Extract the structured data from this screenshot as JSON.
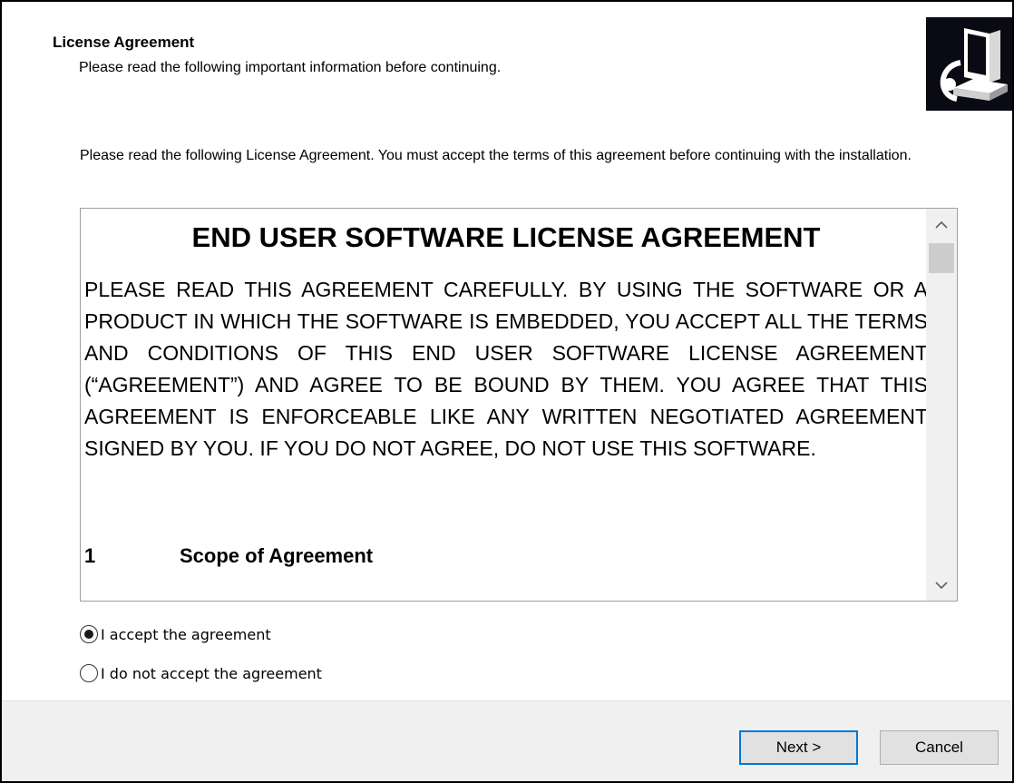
{
  "header": {
    "title": "License Agreement",
    "subtitle": "Please read the following important information before continuing.",
    "logo_icon": "installer-computer-icon"
  },
  "intro": {
    "text": "Please read the following License Agreement. You must accept the terms of this agreement before continuing with the installation."
  },
  "license": {
    "heading": "END USER SOFTWARE LICENSE AGREEMENT",
    "body": "PLEASE READ THIS AGREEMENT CAREFULLY. BY USING THE SOFTWARE OR A PRODUCT IN WHICH THE SOFTWARE IS EMBEDDED, YOU ACCEPT ALL THE TERMS AND CONDITIONS OF THIS END USER SOFTWARE LICENSE AGREEMENT (“AGREEMENT”) AND AGREE TO BE BOUND BY THEM. YOU AGREE THAT THIS AGREEMENT IS ENFORCEABLE LIKE ANY WRITTEN NEGOTIATED AGREEMENT SIGNED BY YOU. IF YOU DO NOT AGREE, DO NOT USE THIS SOFTWARE.",
    "section_number": "1",
    "section_title": "Scope of Agreement"
  },
  "options": {
    "accept_label": "I accept the agreement",
    "decline_label": "I do not accept the agreement",
    "selected": "accept"
  },
  "buttons": {
    "next_label": "Next >",
    "cancel_label": "Cancel"
  },
  "colors": {
    "accent": "#0078d7",
    "footer_bg": "#f0f0f0"
  }
}
